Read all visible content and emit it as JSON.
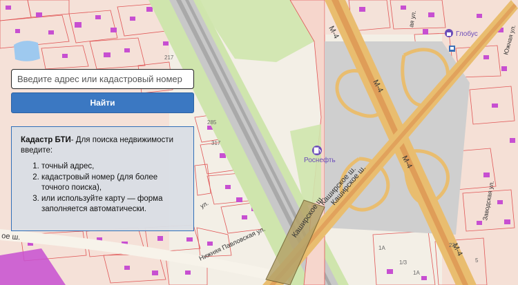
{
  "search": {
    "placeholder": "Введите адрес или кадастровый номер",
    "button_label": "Найти"
  },
  "info": {
    "title": "Кадастр БТИ",
    "intro": "- Для поиска недвижимости введите:",
    "items": [
      "точный адрес,",
      "кадастровый номер (для более точного поиска),",
      "или используйте карту — форма заполняется автоматически."
    ]
  },
  "map": {
    "road_labels": {
      "m4_top": "М-4",
      "m4_mid": "М-4",
      "m4_right": "М-4",
      "m4_bottom": "М-4",
      "kashirskoe_1": "Каширское ш.",
      "kashirskoe_2": "Каширское ш.",
      "kashirskoe_3": "Каширское ш.",
      "kashirskoe_left": "ое ш.",
      "nizhnyaya_pavlovskaya": "Нижняя Павловская ул.",
      "yuzhnaya": "Южная ул.",
      "zavodskaya": "Заводская ул.",
      "ulitsa_mid": "ул.",
      "ulitsa_top": "ая ул."
    },
    "poi": {
      "rosneft": "Роснефть",
      "globus": "Глобус"
    },
    "house_numbers": [
      "217",
      "285",
      "317",
      "1А",
      "1/3",
      "23",
      "5",
      "1А"
    ],
    "colors": {
      "land": "#f3efe6",
      "parcel_fill": "#f6d6cc",
      "parcel_stroke": "#e05555",
      "building": "#c74fd1",
      "green": "#cfe5ad",
      "rail": "#bfbfbf",
      "highway": "#e9bd6f",
      "highway_core": "#d9874a",
      "water": "#9ec9ef",
      "interchange": "#cfcfcf"
    }
  }
}
